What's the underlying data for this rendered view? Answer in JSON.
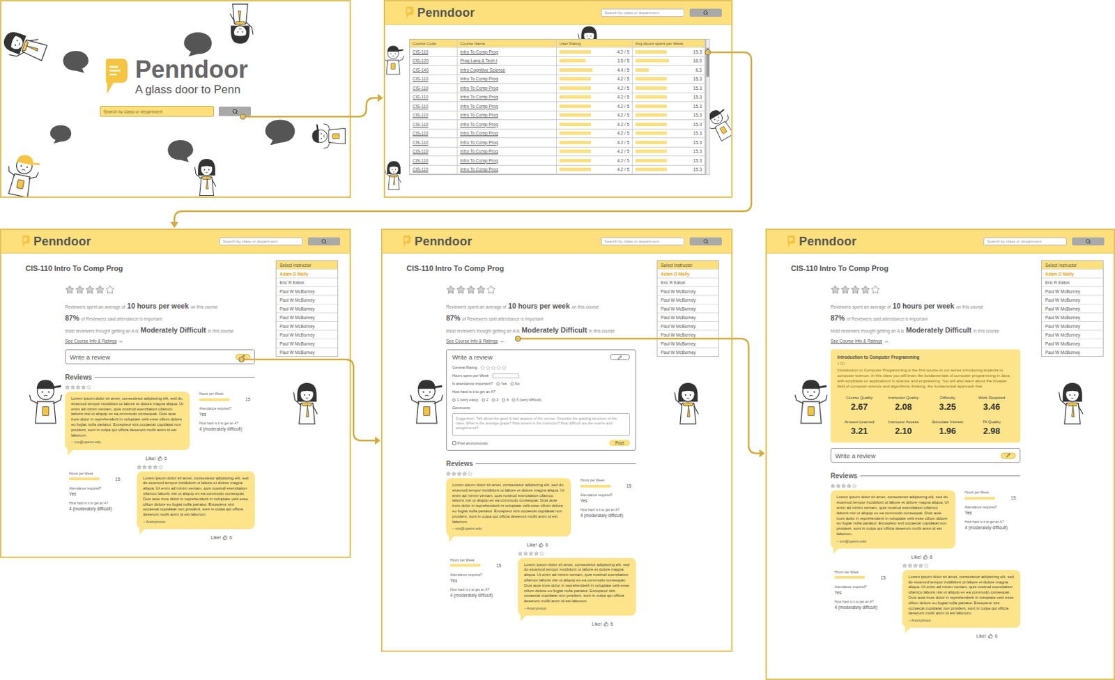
{
  "landing": {
    "logo": "Penndoor",
    "tagline": "A glass door to Penn",
    "search": {
      "placeholder": "Search by class or department"
    }
  },
  "header": {
    "logo": "Penndoor",
    "search": {
      "placeholder": "Search by class or department"
    }
  },
  "results": {
    "columns": [
      "Course Code",
      "Course Name",
      "User Rating",
      "Avg Hours spent per Week"
    ],
    "rows": [
      {
        "code": "CIS-110",
        "name": "Intro To Comp Prog",
        "rating": "4.2 / 5",
        "rating_level": 0.84,
        "hours": "15.3",
        "hours_level": 0.765
      },
      {
        "code": "CIS-120",
        "name": "Prog Lang & Tech I",
        "rating": "3.5 / 5",
        "rating_level": 0.7,
        "hours": "16.0",
        "hours_level": 0.8
      },
      {
        "code": "CIS-140",
        "name": "Intro Cognitive Science",
        "rating": "4.4 / 5",
        "rating_level": 0.88,
        "hours": "6.3",
        "hours_level": 0.315
      },
      {
        "code": "CIS-110",
        "name": "Intro To Comp Prog",
        "rating": "4.2 / 5",
        "rating_level": 0.84,
        "hours": "15.3",
        "hours_level": 0.765
      },
      {
        "code": "CIS-110",
        "name": "Intro To Comp Prog",
        "rating": "4.2 / 5",
        "rating_level": 0.84,
        "hours": "15.3",
        "hours_level": 0.765
      },
      {
        "code": "CIS-110",
        "name": "Intro To Comp Prog",
        "rating": "4.2 / 5",
        "rating_level": 0.84,
        "hours": "15.3",
        "hours_level": 0.765
      },
      {
        "code": "CIS-110",
        "name": "Intro To Comp Prog",
        "rating": "4.2 / 5",
        "rating_level": 0.84,
        "hours": "15.3",
        "hours_level": 0.765
      },
      {
        "code": "CIS-110",
        "name": "Intro To Comp Prog",
        "rating": "4.2 / 5",
        "rating_level": 0.84,
        "hours": "15.3",
        "hours_level": 0.765
      },
      {
        "code": "CIS-110",
        "name": "Intro To Comp Prog",
        "rating": "4.2 / 5",
        "rating_level": 0.84,
        "hours": "15.3",
        "hours_level": 0.765
      },
      {
        "code": "CIS-110",
        "name": "Intro To Comp Prog",
        "rating": "4.2 / 5",
        "rating_level": 0.84,
        "hours": "15.3",
        "hours_level": 0.765
      },
      {
        "code": "CIS-110",
        "name": "Intro To Comp Prog",
        "rating": "4.2 / 5",
        "rating_level": 0.84,
        "hours": "15.3",
        "hours_level": 0.765
      },
      {
        "code": "CIS-110",
        "name": "Intro To Comp Prog",
        "rating": "4.2 / 5",
        "rating_level": 0.84,
        "hours": "15.3",
        "hours_level": 0.765
      },
      {
        "code": "CIS-110",
        "name": "Intro To Comp Prog",
        "rating": "4.2 / 5",
        "rating_level": 0.84,
        "hours": "15.3",
        "hours_level": 0.765
      },
      {
        "code": "CIS-110",
        "name": "Intro To Comp Prog",
        "rating": "4.2 / 5",
        "rating_level": 0.84,
        "hours": "15.3",
        "hours_level": 0.765
      }
    ]
  },
  "course": {
    "title": "CIS-110 Intro To Comp Prog",
    "stars": 4,
    "stats": [
      {
        "before": "Reviewers spent an average of",
        "value": "10 hours per week",
        "after": "on this course"
      },
      {
        "value": "87%",
        "after": "of Reviewers said attendance is important"
      },
      {
        "before": "Most reviewers thought getting an A is",
        "value": "Moderately Difficult",
        "after": "in this course"
      }
    ],
    "info_toggle": "See Course Info & Ratings",
    "info": {
      "title": "Introduction to Computer Programming",
      "credits": "1 CU",
      "description": "Introduction to Computer Programming is the first course in our series introducing students to computer science. In this class you will learn the fundamentals of computer programming in Java, with emphasis on applications in science and engineering. You will also learn about the broader field of computer science and algorithmic thinking, the fundamental approach that",
      "metrics": [
        {
          "label": "Course Quality",
          "value": "2.67"
        },
        {
          "label": "Instructor Quality",
          "value": "2.08"
        },
        {
          "label": "Difficulty",
          "value": "3.25"
        },
        {
          "label": "Work Required",
          "value": "3.46"
        },
        {
          "label": "Amount Learned",
          "value": "3.21"
        },
        {
          "label": "Instructor Access",
          "value": "2.10"
        },
        {
          "label": "Stimulate Interest",
          "value": "1.96"
        },
        {
          "label": "TA Quality",
          "value": "2.98"
        }
      ]
    },
    "write_review": "Write a review",
    "review_form": {
      "title": "Write a review",
      "fields": [
        {
          "kind": "stars",
          "label": "General Rating",
          "stars": 0
        },
        {
          "kind": "text",
          "label": "Hours spent per Week"
        },
        {
          "kind": "radio",
          "label": "Is attendance important?",
          "options": [
            {
              "label": "Yes",
              "selected": false
            },
            {
              "label": "No",
              "selected": false
            }
          ]
        },
        {
          "kind": "scale",
          "label": "How hard is it to get an A?",
          "options": [
            {
              "label": "1 (very easy)",
              "selected": false
            },
            {
              "label": "2",
              "selected": false
            },
            {
              "label": "3",
              "selected": false
            },
            {
              "label": "4",
              "selected": false
            },
            {
              "label": "5 (very difficult)",
              "selected": false
            }
          ]
        },
        {
          "kind": "textarea",
          "label": "Comments",
          "placeholder": "Suggestion: Talk about the good & bad aspects of the course. Describe the grading structure of the class. What is the average grade? How lenient is the instructor? How difficult are the exams and assignments?"
        }
      ],
      "anonymous": {
        "label": "Post anonymously",
        "checked": false
      },
      "submit": "Post"
    },
    "reviews_heading": "Reviews",
    "reviews": [
      {
        "stars": 4,
        "text": "Lorem ipsum dolor sit amet, consectetur adipiscing elit, sed do eiusmod tempor incididunt ut labore et dolore magna aliqua. Ut enim ad minim veniam, quis nostrud exercitation ullamco laboris nisi ut aliquip ex ea commodo consequat. Duis aute irure dolor in reprehenderit in voluptate velit esse cillum dolore eu fugiat nulla pariatur. Excepteur sint occaecat cupidatat non proident, sunt in culpa qui officia deserunt mollit anim id est laborum.",
        "author": "– xxx@upenn.edu",
        "hours_label": "Hours per Week",
        "hours": "15",
        "hours_level": 0.75,
        "attendance_label": "Attendance required?",
        "attendance": "Yes",
        "difficulty_label": "How hard is it to get an A?",
        "difficulty": "4 (moderately difficult)",
        "like_label": "Like!",
        "likes": "6"
      },
      {
        "stars": 4,
        "text": "Lorem ipsum dolor sit amet, consectetur adipiscing elit, sed do eiusmod tempor incididunt ut labore et dolore magna aliqua. Ut enim ad minim veniam, quis nostrud exercitation ullamco laboris nisi ut aliquip ex ea commodo consequat. Duis aute irure dolor in reprehenderit in voluptate velit esse cillum dolore eu fugiat nulla pariatur. Excepteur sint occaecat cupidatat non proident, sunt in culpa qui officia deserunt mollit anim id est laborum.",
        "author": "– Anonymous",
        "hours_label": "Hours per Week",
        "hours": "15",
        "hours_level": 0.75,
        "attendance_label": "Attendance required?",
        "attendance": "Yes",
        "difficulty_label": "How hard is it to get an A?",
        "difficulty": "4 (moderately difficult)",
        "like_label": "Like!",
        "likes": "6"
      }
    ],
    "instructors": {
      "heading": "Select Instructor",
      "items": [
        {
          "name": "Adam D Mally",
          "selected": true
        },
        {
          "name": "Eric R Eaton",
          "selected": false
        },
        {
          "name": "Paul W McBurney",
          "selected": false
        },
        {
          "name": "Paul W McBurney",
          "selected": false
        },
        {
          "name": "Paul W McBurney",
          "selected": false
        },
        {
          "name": "Paul W McBurney",
          "selected": false
        },
        {
          "name": "Paul W McBurney",
          "selected": false
        },
        {
          "name": "Paul W McBurney",
          "selected": false
        },
        {
          "name": "Paul W McBurney",
          "selected": false
        },
        {
          "name": "Paul W McBurney",
          "selected": false
        }
      ]
    }
  },
  "course_frames": [
    {
      "info_expanded": false,
      "review_form_open": false
    },
    {
      "info_expanded": false,
      "review_form_open": true
    },
    {
      "info_expanded": true,
      "review_form_open": false
    }
  ]
}
